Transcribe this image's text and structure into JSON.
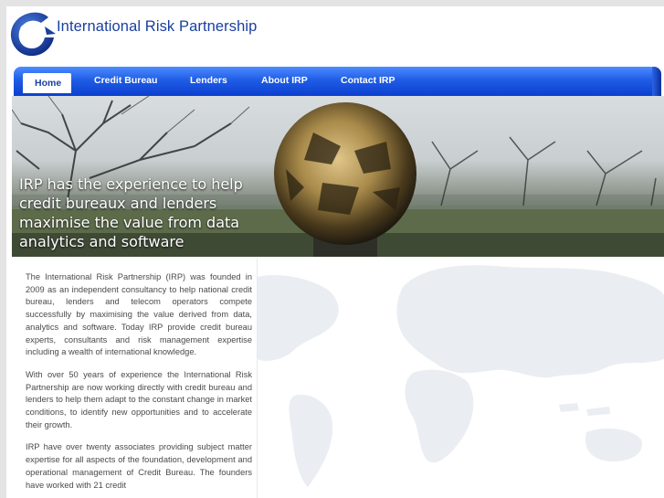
{
  "header": {
    "logo_text": "International Risk Partnership",
    "logo_icon": "globe-icon",
    "brand_color": "#1a3f9f"
  },
  "nav": {
    "items": [
      {
        "label": "Home",
        "active": true
      },
      {
        "label": "Credit Bureau",
        "active": false
      },
      {
        "label": "Lenders",
        "active": false
      },
      {
        "label": "About IRP",
        "active": false
      },
      {
        "label": "Contact IRP",
        "active": false
      }
    ],
    "bar_color": "#1f5de6"
  },
  "hero": {
    "caption_lines": [
      "IRP has the experience to help",
      "credit bureaux and lenders",
      "maximise the value from data",
      "analytics and software"
    ]
  },
  "content": {
    "paragraphs": [
      "The International Risk Partnership (IRP) was founded in 2009 as an independent consultancy to help national credit bureau, lenders and telecom operators compete successfully by maximising the value derived from data, analytics and software. Today IRP provide credit bureau experts, consultants and risk management expertise including a wealth of international knowledge.",
      "With over 50 years of experience the International Risk Partnership are now working directly with credit bureau and lenders to help them adapt to the constant change in market conditions, to identify new opportunities and to accelerate their growth.",
      "IRP have over twenty associates providing subject matter expertise for all aspects of the foundation, development and operational management of Credit Bureau. The founders have worked with 21 credit"
    ]
  }
}
